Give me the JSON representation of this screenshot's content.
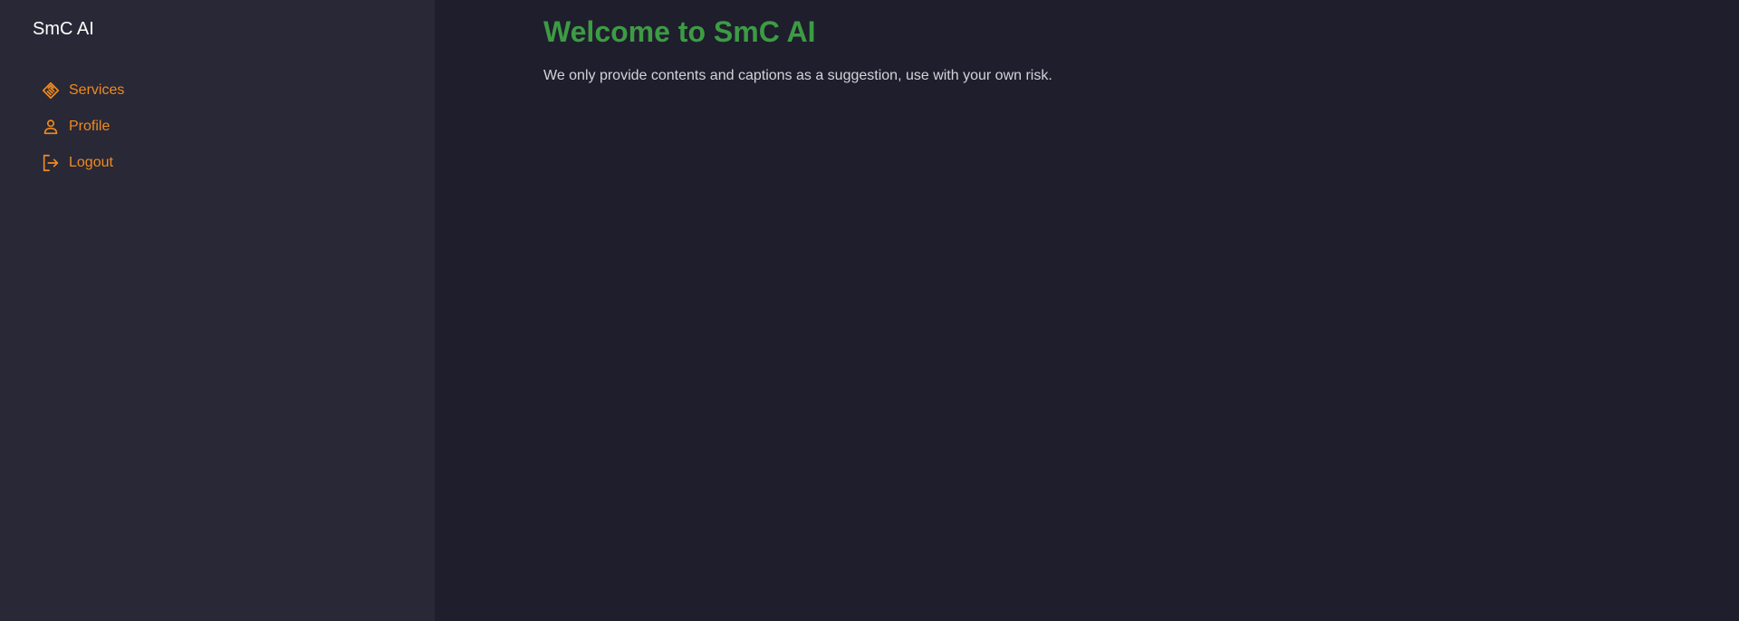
{
  "sidebar": {
    "brand": "SmC AI",
    "items": [
      {
        "label": "Services",
        "icon": "handshake-icon"
      },
      {
        "label": "Profile",
        "icon": "user-icon"
      },
      {
        "label": "Logout",
        "icon": "logout-icon"
      }
    ]
  },
  "main": {
    "title": "Welcome to SmC AI",
    "subtitle": "We only provide contents and captions as a suggestion, use with your own risk."
  },
  "colors": {
    "sidebar_bg": "#292836",
    "main_bg": "#1f1e2d",
    "accent": "#f18b1e",
    "title": "#3d9b44",
    "text": "#d4d3da"
  }
}
